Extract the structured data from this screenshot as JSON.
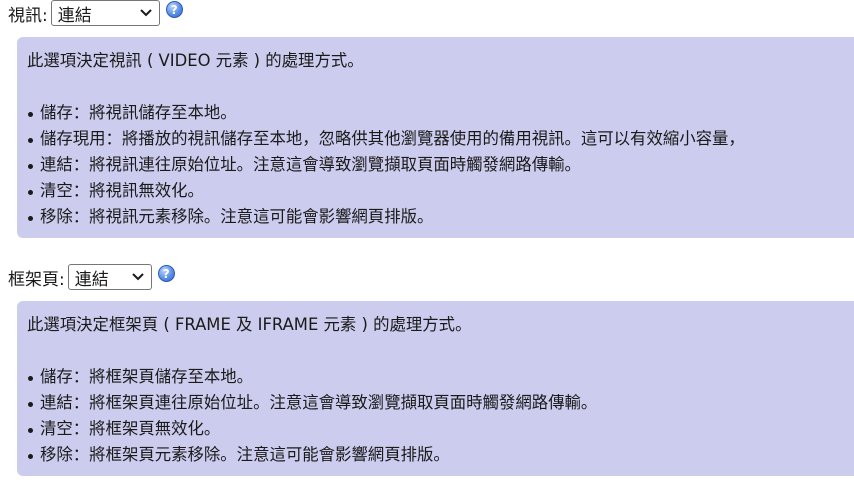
{
  "video": {
    "label": "視訊:",
    "select_value": "連結",
    "help_icon": "?",
    "description": "此選項決定視訊 ( VIDEO 元素 ) 的處理方式。",
    "items": [
      "儲存：將視訊儲存至本地。",
      "儲存現用：將播放的視訊儲存至本地，忽略供其他瀏覽器使用的備用視訊。這可以有效縮小容量，",
      "連結：將視訊連往原始位址。注意這會導致瀏覽擷取頁面時觸發網路傳輸。",
      "清空：將視訊無效化。",
      "移除：將視訊元素移除。注意這可能會影響網頁排版。"
    ]
  },
  "frame": {
    "label": "框架頁:",
    "select_value": "連結",
    "help_icon": "?",
    "description": "此選項決定框架頁 ( FRAME 及 IFRAME 元素 ) 的處理方式。",
    "items": [
      "儲存：將框架頁儲存至本地。",
      "連結：將框架頁連往原始位址。注意這會導致瀏覽擷取頁面時觸發網路傳輸。",
      "清空：將框架頁無效化。",
      "移除：將框架頁元素移除。注意這可能會影響網頁排版。"
    ]
  }
}
